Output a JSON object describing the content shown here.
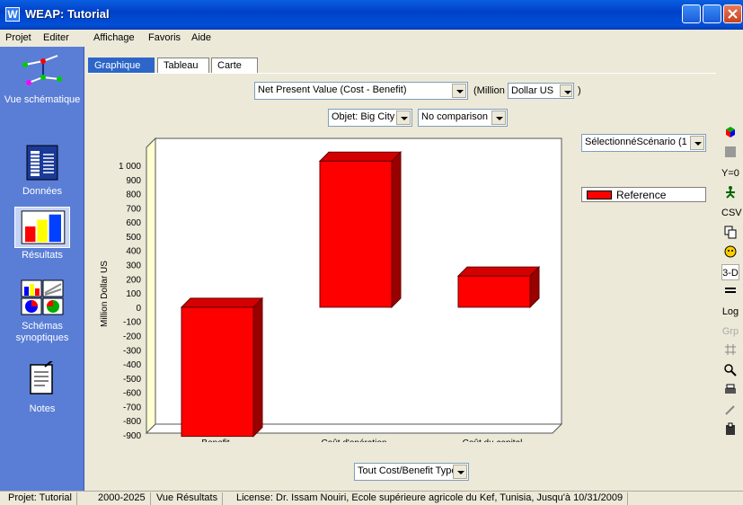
{
  "window": {
    "title": "WEAP: Tutorial",
    "icon_letter": "W"
  },
  "menu": [
    "Projet",
    "Editer",
    "Affichage",
    "Favoris",
    "Aide"
  ],
  "sidebar": [
    {
      "label": "Vue schématique",
      "icon": "schematic-icon"
    },
    {
      "label": "Données",
      "icon": "data-icon"
    },
    {
      "label": "Résultats",
      "icon": "results-icon",
      "active": true
    },
    {
      "label": "Schémas synoptiques",
      "icon": "overviews-icon"
    },
    {
      "label": "Notes",
      "icon": "notes-icon"
    }
  ],
  "tabs": [
    "Graphique",
    "Tableau",
    "Carte"
  ],
  "controls": {
    "variable": "Net Present Value (Cost - Benefit)",
    "unit_prefix": "(Million",
    "unit_select": "Dollar US",
    "unit_suffix": ")",
    "object_select": "Objet: Big City",
    "comparison_select": "No comparison",
    "scenario_select": "SélectionnéScénario (1",
    "bottom_select": "Tout Cost/Benefit Type"
  },
  "legend": {
    "entries": [
      "Reference"
    ]
  },
  "right_toolbar": [
    "Y=0",
    "CSV",
    "3-D",
    "Log",
    "Grp"
  ],
  "chart_data": {
    "type": "bar",
    "categories": [
      "Benefit",
      "Coût d'opération",
      "Coût du capital"
    ],
    "series": [
      {
        "name": "Reference",
        "color": "#ff0000",
        "values": [
          -910,
          1030,
          220
        ]
      }
    ],
    "ylabel": "Million Dollar US",
    "ylim": [
      -900,
      1000
    ],
    "yticks": [
      "1 000",
      "900",
      "800",
      "700",
      "600",
      "500",
      "400",
      "300",
      "200",
      "100",
      "0",
      "-100",
      "-200",
      "-300",
      "-400",
      "-500",
      "-600",
      "-700",
      "-800",
      "-900"
    ],
    "style": "3-D",
    "grid": false
  },
  "status": [
    "Projet: Tutorial",
    "2000-2025",
    "Vue Résultats",
    "License: Dr. Issam Nouiri, Ecole supérieure agricole du Kef, Tunisia, Jusqu'à 10/31/2009"
  ]
}
